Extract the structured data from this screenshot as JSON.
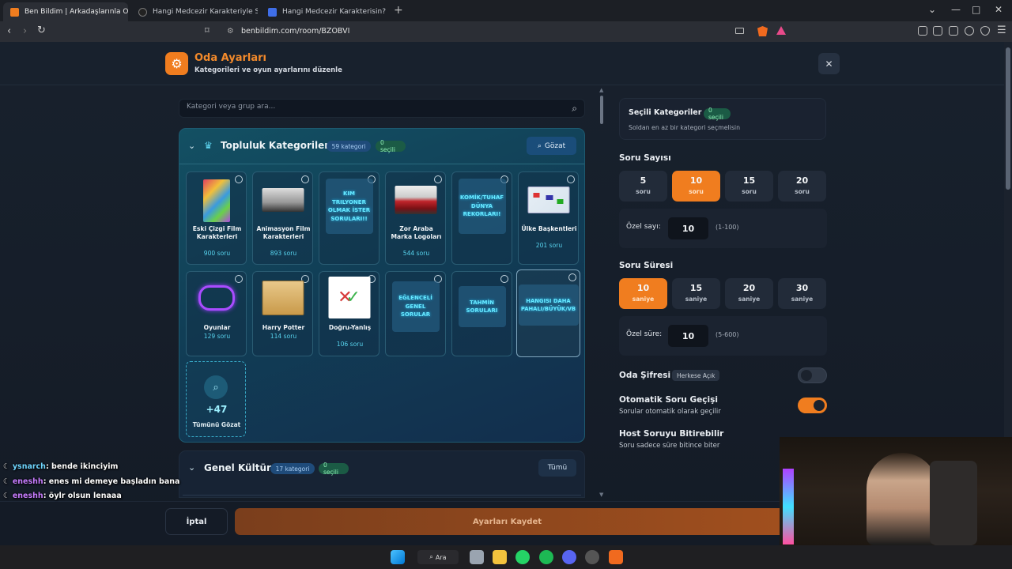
{
  "browser": {
    "tabs": [
      {
        "title": "Ben Bildim | Arkadaşlarınla Onlin",
        "favicon_color": "#f07d1f"
      },
      {
        "title": "Hangi Medcezir Karakteriyle Sevgili O",
        "favicon_color": "#222222"
      },
      {
        "title": "Hangi Medcezir Karakterisin? - Test",
        "favicon_color": "#3f6ee8"
      }
    ],
    "url": "benbildim.com/room/BZOBVI"
  },
  "header": {
    "title": "Oda Ayarları",
    "subtitle": "Kategorileri ve oyun ayarlarını düzenle"
  },
  "search": {
    "placeholder": "Kategori veya grup ara..."
  },
  "community": {
    "title": "Topluluk Kategorileri",
    "count_badge": "59 kategori",
    "selected_badge": "0 seçili",
    "browse_label": "Gözat",
    "cards": [
      {
        "name": "Eski Çizgi Film Karakterleri",
        "count": "900 soru"
      },
      {
        "name": "Animasyon Film Karakterleri",
        "count": "893 soru"
      },
      {
        "neon": "KIM TRILYONER OLMAK İSTER SORULARI!!"
      },
      {
        "name": "Zor Araba Marka Logoları",
        "count": "544 soru"
      },
      {
        "neon": "KOMİK/TUHAF DÜNYA REKORLARI!"
      },
      {
        "name": "Ülke Başkentleri",
        "count": "201 soru"
      },
      {
        "name": "Oyunlar",
        "count": "129 soru"
      },
      {
        "name": "Harry Potter",
        "count": "114 soru"
      },
      {
        "name": "Doğru-Yanlış",
        "count": "106 soru"
      },
      {
        "neon": "EĞLENCELİ GENEL SORULAR"
      },
      {
        "neon": "TAHMİN SORULARI"
      },
      {
        "neon": "HANGISI DAHA PAHALI/BÜYÜK/VB"
      }
    ],
    "more_count": "+47",
    "more_label": "Tümünü Gözat"
  },
  "general": {
    "title": "Genel Kültür",
    "count_badge": "17 kategori",
    "selected_badge": "0 seçili",
    "all_label": "Tümü"
  },
  "selected": {
    "title": "Seçili Kategoriler",
    "badge": "0 seçili",
    "hint": "Soldan en az bir kategori seçmelisin"
  },
  "question_count": {
    "label": "Soru Sayısı",
    "unit": "soru",
    "options": [
      "5",
      "10",
      "15",
      "20"
    ],
    "selected": "10",
    "custom_label": "Özel sayı:",
    "custom_value": "10",
    "range": "(1-100)"
  },
  "question_time": {
    "label": "Soru Süresi",
    "unit": "saniye",
    "options": [
      "10",
      "15",
      "20",
      "30"
    ],
    "selected": "10",
    "custom_label": "Özel süre:",
    "custom_value": "10",
    "range": "(5-600)"
  },
  "room_password": {
    "label": "Oda Şifresi",
    "badge": "Herkese Açık",
    "enabled": false
  },
  "auto_next": {
    "label": "Otomatik Soru Geçişi",
    "sub": "Sorular otomatik olarak geçilir",
    "enabled": true
  },
  "host_end": {
    "label": "Host Soruyu Bitirebilir",
    "sub": "Soru sadece süre bitince biter",
    "enabled": false
  },
  "footer": {
    "cancel": "İptal",
    "save": "Ayarları Kaydet"
  },
  "chat": [
    {
      "user": "ysnarch",
      "user_color": "#6fd6ff",
      "text": ": bende ikinciyim"
    },
    {
      "user": "eneshh",
      "user_color": "#c77dff",
      "text": ": enes mi demeye başladın bana"
    },
    {
      "user": "eneshh",
      "user_color": "#c77dff",
      "text": ": öylr olsun lenaaa"
    }
  ],
  "taskbar": {
    "search_label": "Ara"
  },
  "colors": {
    "accent": "#f07d1f",
    "panel": "#135063",
    "cyan": "#58d4ee"
  }
}
